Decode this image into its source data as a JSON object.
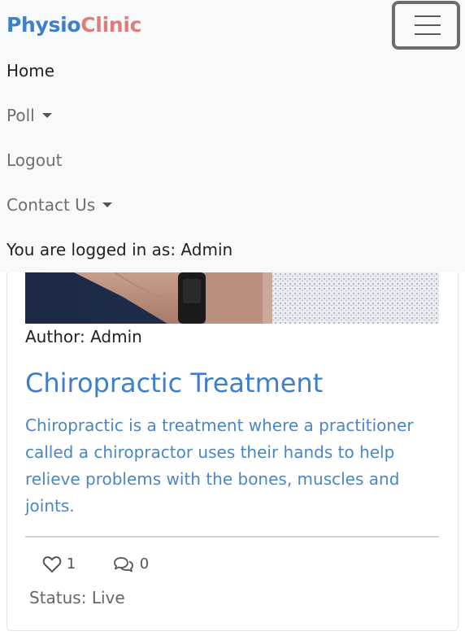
{
  "brand": {
    "part1": "Physio",
    "part2": "Clinic"
  },
  "nav": {
    "items": [
      {
        "label": "Home"
      },
      {
        "label": "Poll"
      },
      {
        "label": "Logout"
      },
      {
        "label": "Contact Us"
      }
    ],
    "logged_in": "You are logged in as: Admin"
  },
  "post": {
    "author": "Author: Admin",
    "title": "Chiropractic Treatment",
    "body": "Chiropractic is a treatment where a practitioner called a chiropractor uses their hands to help relieve problems with the bones, muscles and joints.",
    "likes": "1",
    "comments": "0",
    "status": "Status: Live"
  },
  "icons": {
    "toggler": "menu-icon",
    "like": "heart-icon",
    "comment": "comments-icon"
  },
  "colors": {
    "brand_blue": "#3d7fc9",
    "brand_pink": "#e07c79",
    "navbar_bg": "#f8f9fa"
  }
}
